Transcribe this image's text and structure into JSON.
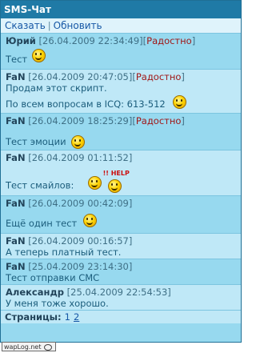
{
  "title": "SMS-Чат",
  "actions": {
    "say": "Сказать",
    "separator": "|",
    "refresh": "Обновить"
  },
  "messages": [
    {
      "nick": "Юрий",
      "time": "[26.04.2009 22:34:49]",
      "mood": "Радостно",
      "text": "Тест",
      "icon": "smiley-face-icon"
    },
    {
      "nick": "FaN",
      "time": "[26.04.2009 20:47:05]",
      "mood": "Радостно",
      "text": "Продам этот скрипт.",
      "text2": "По всем вопросам в ICQ: 613-512",
      "icon": "smiley-face-icon"
    },
    {
      "nick": "FaN",
      "time": "[26.04.2009 18:25:29]",
      "mood": "Радостно",
      "text": "Тест эмоции",
      "icon": "smiley-face-icon"
    },
    {
      "nick": "FaN",
      "time": "[26.04.2009 01:11:52]",
      "text": "Тест смайлов:",
      "help": "!! HELP",
      "icon": "smiley-face-icon"
    },
    {
      "nick": "FaN",
      "time": "[26.04.2009 00:42:09]",
      "text": "Ещё один тест",
      "icon": "smiley-face-icon"
    },
    {
      "nick": "FaN",
      "time": "[26.04.2009 00:16:57]",
      "text": "А теперь платный тест."
    },
    {
      "nick": "FaN",
      "time": "[25.04.2009 23:14:30]",
      "text": "Тест отправки СМС"
    },
    {
      "nick": "Александр",
      "time": "[25.04.2009 22:54:53]",
      "text": "У меня тоже хорошо."
    }
  ],
  "pagination": {
    "label": "Страницы:",
    "current": "1",
    "next": "2"
  },
  "footer": {
    "badge": "wapLog.net"
  }
}
